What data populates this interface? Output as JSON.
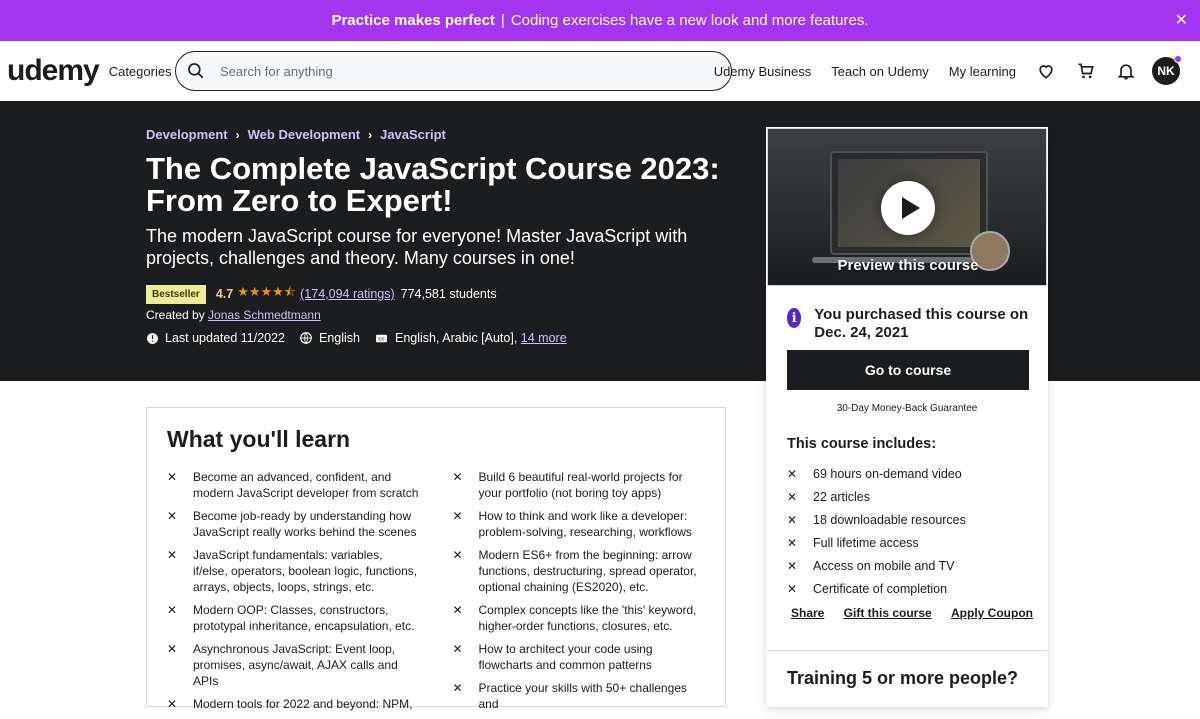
{
  "banner": {
    "bold": "Practice makes perfect",
    "separator": "|",
    "text": "Coding exercises have a new look and more features."
  },
  "header": {
    "brand": "udemy",
    "categories": "Categories",
    "search_placeholder": "Search for anything",
    "udemy_business": "Udemy Business",
    "teach": "Teach on Udemy",
    "my_learning": "My learning",
    "avatar_initials": "NK"
  },
  "course": {
    "breadcrumbs": [
      "Development",
      "Web Development",
      "JavaScript"
    ],
    "title": "The Complete JavaScript Course 2023: From Zero to Expert!",
    "subtitle": "The modern JavaScript course for everyone! Master JavaScript with projects, challenges and theory. Many courses in one!",
    "badge": "Bestseller",
    "rating": "4.7",
    "stars": "★★★★⯪",
    "rating_count": "(174,094 ratings)",
    "students": "774,581 students",
    "created_prefix": "Created by",
    "instructor": "Jonas Schmedtmann",
    "last_updated": "Last updated 11/2022",
    "language": "English",
    "captions": "English, Arabic [Auto],",
    "captions_more": "14 more"
  },
  "sidebar": {
    "preview_label": "Preview this course",
    "purchased": "You purchased this course on Dec. 24, 2021",
    "go_to_course": "Go to course",
    "guarantee": "30-Day Money-Back Guarantee",
    "includes_title": "This course includes:",
    "includes": [
      "69 hours on-demand video",
      "22 articles",
      "18 downloadable resources",
      "Full lifetime access",
      "Access on mobile and TV",
      "Certificate of completion"
    ],
    "share": "Share",
    "gift": "Gift this course",
    "coupon": "Apply Coupon",
    "training": "Training 5 or more people?"
  },
  "learn": {
    "title": "What you'll learn",
    "left": [
      "Become an advanced, confident, and modern JavaScript developer from scratch",
      "Become job-ready by understanding how JavaScript really works behind the scenes",
      "JavaScript fundamentals: variables, if/else, operators, boolean logic, functions, arrays, objects, loops, strings, etc.",
      "Modern OOP: Classes, constructors, prototypal inheritance, encapsulation, etc.",
      "Asynchronous JavaScript: Event loop, promises, async/await, AJAX calls and APIs",
      "Modern tools for 2022 and beyond: NPM,"
    ],
    "right": [
      "Build 6 beautiful real-world projects for your portfolio (not boring toy apps)",
      "How to think and work like a developer: problem-solving, researching, workflows",
      "Modern ES6+ from the beginning: arrow functions, destructuring, spread operator, optional chaining (ES2020), etc.",
      "Complex concepts like the 'this' keyword, higher-order functions, closures, etc.",
      "How to architect your code using flowcharts and common patterns",
      "Practice your skills with 50+ challenges and"
    ]
  }
}
